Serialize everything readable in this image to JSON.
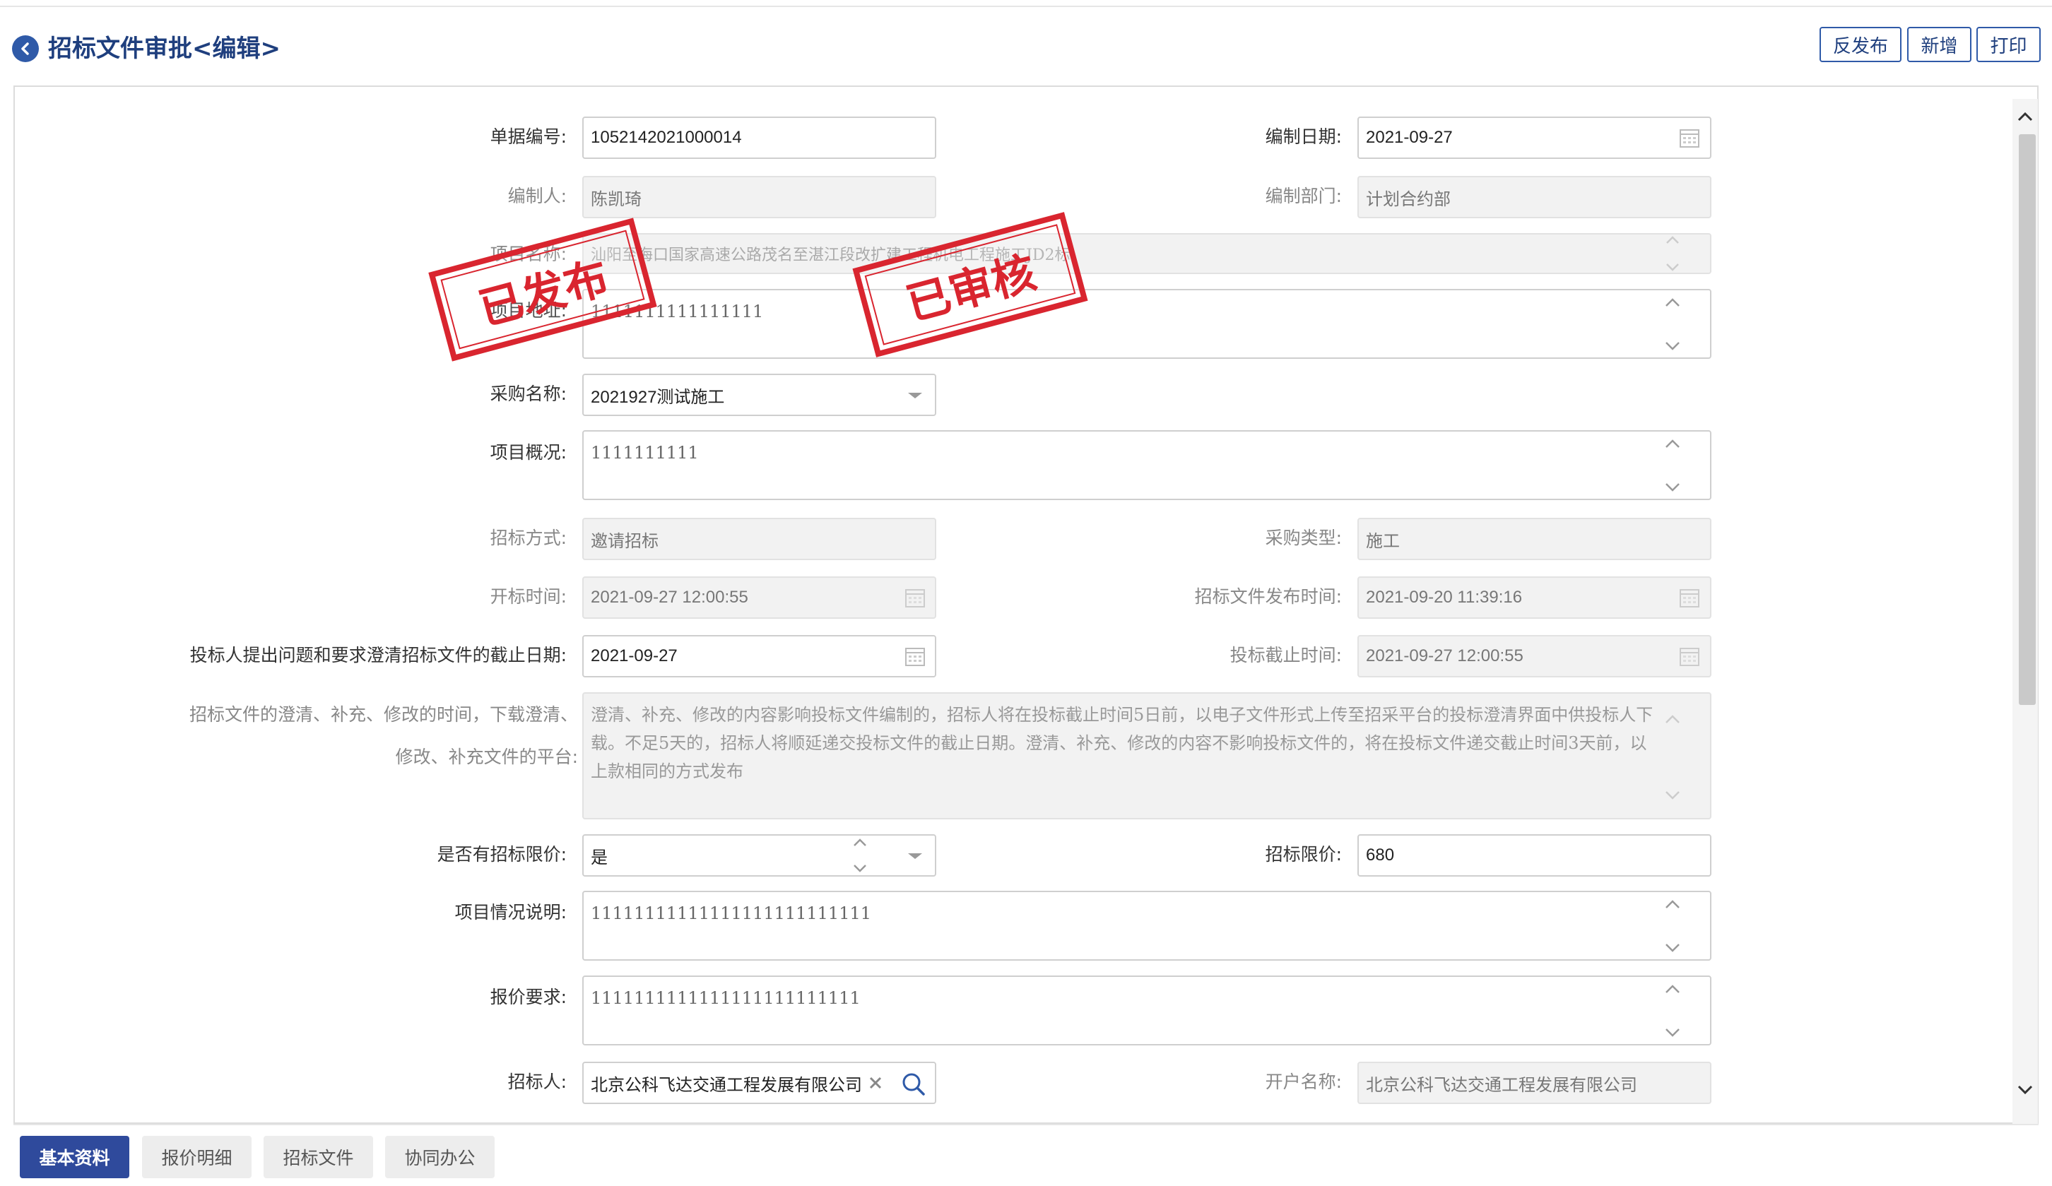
{
  "header": {
    "title": "招标文件审批<编辑>",
    "buttons": {
      "unpublish": "反发布",
      "add": "新增",
      "print": "打印"
    }
  },
  "stamps": {
    "published": "已发布",
    "reviewed": "已审核"
  },
  "form": {
    "doc_no": {
      "label": "单据编号:",
      "value": "1052142021000014"
    },
    "compile_date": {
      "label": "编制日期:",
      "value": "2021-09-27"
    },
    "compiler": {
      "label": "编制人:",
      "value": "陈凯琦"
    },
    "department": {
      "label": "编制部门:",
      "value": "计划合约部"
    },
    "project_name": {
      "label": "项目名称:",
      "value": "汕阳至海口国家高速公路茂名至湛江段改扩建工程机电工程施工JD2标"
    },
    "project_address": {
      "label": "项目地址:",
      "value": "1111111111111111"
    },
    "purchase_name": {
      "label": "采购名称:",
      "value": "2021927测试施工"
    },
    "project_overview": {
      "label": "项目概况:",
      "value": "1111111111"
    },
    "tender_method": {
      "label": "招标方式:",
      "value": "邀请招标"
    },
    "purchase_type": {
      "label": "采购类型:",
      "value": "施工"
    },
    "open_time": {
      "label": "开标时间:",
      "value": "2021-09-27 12:00:55"
    },
    "publish_time": {
      "label": "招标文件发布时间:",
      "value": "2021-09-20 11:39:16"
    },
    "clarify_deadline": {
      "label": "投标人提出问题和要求澄清招标文件的截止日期:",
      "value": "2021-09-27"
    },
    "bid_deadline": {
      "label": "投标截止时间:",
      "value": "2021-09-27 12:00:55"
    },
    "clarify_platform": {
      "label": "招标文件的澄清、补充、修改的时间，下载澄清、修改、补充文件的平台:",
      "value": "澄清、补充、修改的内容影响投标文件编制的，招标人将在投标截止时间5日前，以电子文件形式上传至招采平台的投标澄清界面中供投标人下载。不足5天的，招标人将顺延递交投标文件的截止日期。澄清、补充、修改的内容不影响投标文件的，将在投标文件递交截止时间3天前，以上款相同的方式发布"
    },
    "has_limit": {
      "label": "是否有招标限价:",
      "value": "是"
    },
    "limit_price": {
      "label": "招标限价:",
      "value": "680"
    },
    "project_desc": {
      "label": "项目情况说明:",
      "value": "11111111111111111111111111"
    },
    "quote_req": {
      "label": "报价要求:",
      "value": "1111111111111111111111111"
    },
    "tenderer": {
      "label": "招标人:",
      "value": "北京公科飞达交通工程发展有限公司"
    },
    "account_name": {
      "label": "开户名称:",
      "value": "北京公科飞达交通工程发展有限公司"
    }
  },
  "tabs": [
    "基本资料",
    "报价明细",
    "招标文件",
    "协同办公"
  ]
}
